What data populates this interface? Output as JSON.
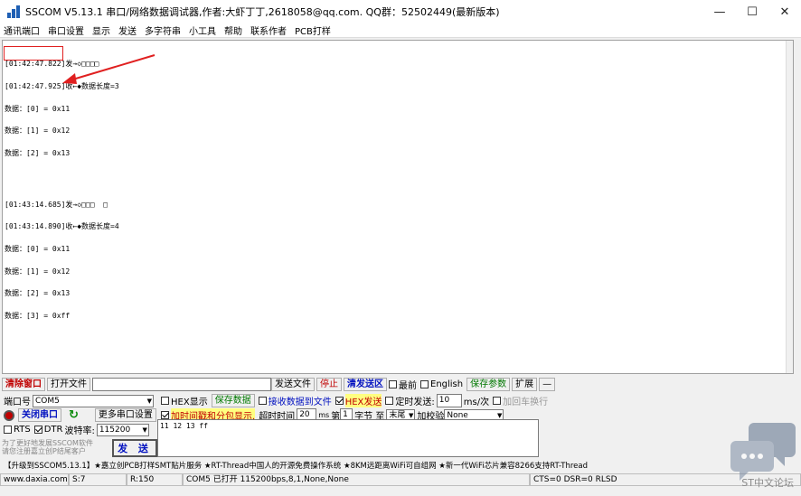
{
  "title": "SSCOM V5.13.1 串口/网络数据调试器,作者:大虾丁丁,2618058@qq.com. QQ群：52502449(最新版本)",
  "window_controls": {
    "minimize": "—",
    "maximize": "☐",
    "close": "✕"
  },
  "menu": [
    "通讯端口",
    "串口设置",
    "显示",
    "发送",
    "多字符串",
    "小工具",
    "帮助",
    "联系作者",
    "PCB打样"
  ],
  "receive_lines": [
    "[01:42:47.822]发→◇□□□□",
    "[01:42:47.925]收←◆数据长度=3",
    "数据：[0] = 0x11",
    "数据：[1] = 0x12",
    "数据：[2] = 0x13",
    "",
    "[01:43:14.685]发→◇□□□  □",
    "[01:43:14.890]收←◆数据长度=4",
    "数据：[0] = 0x11",
    "数据：[1] = 0x12",
    "数据：[2] = 0x13",
    "数据：[3] = 0xff"
  ],
  "toolbar": {
    "clear_window": "清除窗口",
    "open_file": "打开文件",
    "file_path": "",
    "send_file": "发送文件",
    "stop": "停止",
    "clear_send": "清发送区",
    "topmost": "最前",
    "english": "English",
    "save_params": "保存参数",
    "expand": "扩展",
    "collapse": "—"
  },
  "port": {
    "port_label": "端口号",
    "port_value": "COM5",
    "close_port": "关闭串口",
    "more_settings": "更多串口设置",
    "rts": "RTS",
    "dtr": "DTR",
    "baud_label": "波特率:",
    "baud_value": "115200"
  },
  "options": {
    "hex_display": "HEX显示",
    "save_data": "保存数据",
    "recv_to_file": "接收数据到文件",
    "hex_send": "HEX发送",
    "timed_send": "定时发送:",
    "timed_value": "10",
    "timed_unit": "ms/次",
    "add_crlf": "加回车换行",
    "timestamp": "加时间戳和分包显示.",
    "timeout_label": "超时时间",
    "timeout_value": "20",
    "timeout_unit": "ms",
    "nth_label": "第",
    "nth_value": "1",
    "byte_label": "字节 至",
    "end_value": "末尾",
    "checksum_label": "加校验",
    "checksum_value": "None"
  },
  "send_text": "11 12 13 ff",
  "send_button": "发 送",
  "promo": "为了更好地发展SSCOM软件\n请您注册嘉立创P结尾客户",
  "ticker": "【升级到SSCOM5.13.1】★嘉立创PCB打样SMT贴片服务 ★RT-Thread中国人的开源免费操作系统 ★8KM远距离WiFi可自组网 ★新一代WiFi芯片兼容8266支持RT-Thread",
  "status": {
    "site": "www.daxia.com",
    "sent": "S:7",
    "received": "R:150",
    "port_state": "COM5 已打开  115200bps,8,1,None,None",
    "lines": "CTS=0 DSR=0 RLSD"
  },
  "watermark": "ST中文论坛",
  "colors": {
    "accent_red": "#e02020",
    "stop_red": "#c00000",
    "send_blue": "#0010c0",
    "save_green": "#007800"
  }
}
